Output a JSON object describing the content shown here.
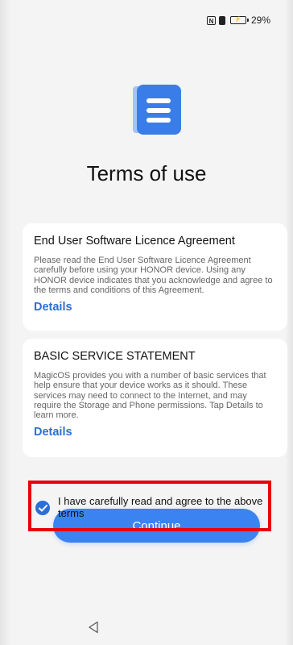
{
  "status_bar": {
    "nfc_glyph": "N",
    "battery_percent": "29%"
  },
  "logo": {
    "icon": "document-icon",
    "colors": {
      "back": "#a7c4f5",
      "front": "#3b7de8",
      "lines": "#ffffff"
    }
  },
  "title": "Terms of use",
  "cards": [
    {
      "title": "End User Software Licence Agreement",
      "body": "Please read the End User Software Licence Agreement carefully before using your HONOR device. Using any HONOR device indicates that you acknowledge and agree to the terms and conditions of this Agreement.",
      "link": "Details"
    },
    {
      "title": "BASIC SERVICE STATEMENT",
      "body": "MagicOS provides you with a number of basic services that help ensure that your device works as it should. These services may need to connect to the Internet, and may require the Storage and Phone permissions. Tap Details to learn more.",
      "link": "Details"
    }
  ],
  "agree": {
    "checked": true,
    "label": "I have carefully read and agree to the above terms"
  },
  "continue_label": "Continue",
  "colors": {
    "accent": "#3b83f0",
    "link": "#2b6fd6",
    "highlight": "#e8000c"
  }
}
